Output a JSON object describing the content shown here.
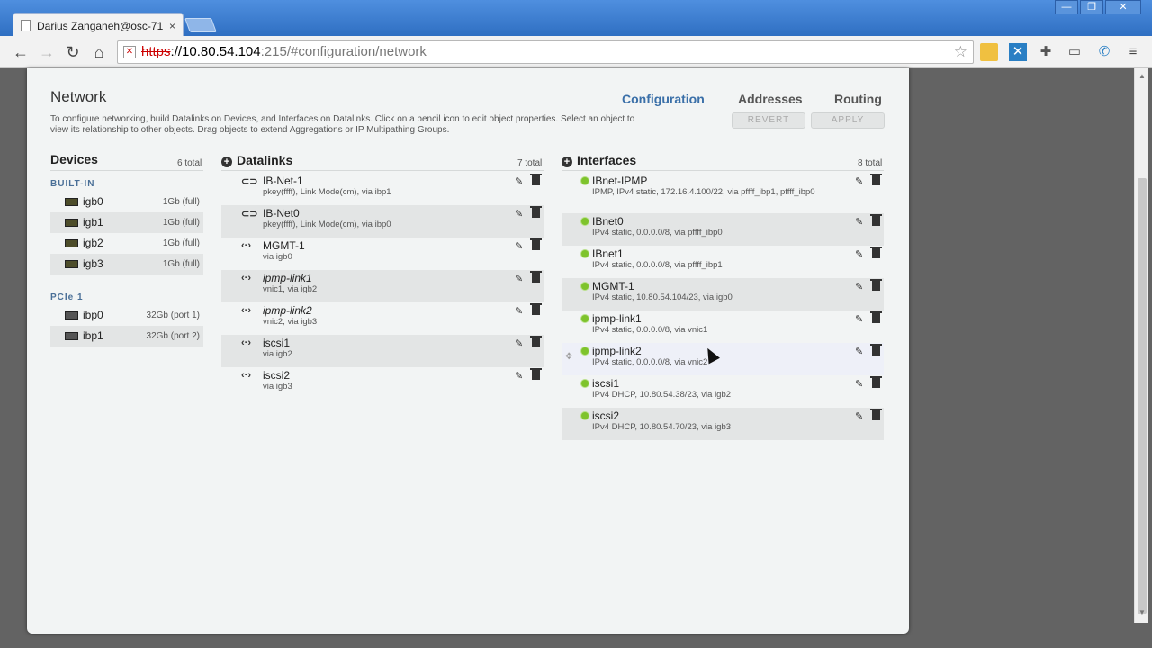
{
  "browser": {
    "tab_title": "Darius Zanganeh@osc-71",
    "tab_close": "×",
    "url_scheme": "https",
    "url_host": "://10.80.54.104",
    "url_path": ":215/#configuration/network",
    "window_buttons": [
      "—",
      "❐",
      "✕"
    ]
  },
  "page": {
    "title": "Network",
    "tabs": [
      "Configuration",
      "Addresses",
      "Routing"
    ],
    "active_tab": "Configuration",
    "description": "To configure networking, build Datalinks on Devices, and Interfaces on Datalinks. Click on a pencil icon to edit object properties. Select an object to view its relationship to other objects. Drag objects to extend Aggregations or IP Multipathing Groups.",
    "revert_label": "REVERT",
    "apply_label": "APPLY"
  },
  "devices": {
    "title": "Devices",
    "count": "6 total",
    "groups": [
      {
        "label": "BUILT-IN",
        "items": [
          {
            "name": "igb0",
            "speed": "1Gb (full)"
          },
          {
            "name": "igb1",
            "speed": "1Gb (full)"
          },
          {
            "name": "igb2",
            "speed": "1Gb (full)"
          },
          {
            "name": "igb3",
            "speed": "1Gb (full)"
          }
        ]
      },
      {
        "label": "PCIe 1",
        "items": [
          {
            "name": "ibp0",
            "speed": "32Gb (port 1)"
          },
          {
            "name": "ibp1",
            "speed": "32Gb (port 2)"
          }
        ]
      }
    ]
  },
  "datalinks": {
    "title": "Datalinks",
    "count": "7 total",
    "items": [
      {
        "icon": "⊂⊃",
        "name": "IB-Net-1",
        "sub": "pkey(ffff), Link Mode(cm), via ibp1"
      },
      {
        "icon": "⊂⊃",
        "name": "IB-Net0",
        "sub": "pkey(ffff), Link Mode(cm), via ibp0"
      },
      {
        "icon": "‹·›",
        "name": "MGMT-1",
        "sub": "via igb0"
      },
      {
        "icon": "‹·›",
        "name": "ipmp-link1",
        "sub": "vnic1, via igb2"
      },
      {
        "icon": "‹·›",
        "name": "ipmp-link2",
        "sub": "vnic2, via igb3"
      },
      {
        "icon": "‹·›",
        "name": "iscsi1",
        "sub": "via igb2"
      },
      {
        "icon": "‹·›",
        "name": "iscsi2",
        "sub": "via igb3"
      }
    ]
  },
  "interfaces": {
    "title": "Interfaces",
    "count": "8 total",
    "items": [
      {
        "name": "IBnet-IPMP",
        "sub": "IPMP, IPv4 static, 172.16.4.100/22, via pffff_ibp1, pffff_ibp0"
      },
      {
        "name": "IBnet0",
        "sub": "IPv4 static, 0.0.0.0/8, via pffff_ibp0"
      },
      {
        "name": "IBnet1",
        "sub": "IPv4 static, 0.0.0.0/8, via pffff_ibp1"
      },
      {
        "name": "MGMT-1",
        "sub": "IPv4 static, 10.80.54.104/23, via igb0"
      },
      {
        "name": "ipmp-link1",
        "sub": "IPv4 static, 0.0.0.0/8, via vnic1"
      },
      {
        "name": "ipmp-link2",
        "sub": "IPv4 static, 0.0.0.0/8, via vnic2"
      },
      {
        "name": "iscsi1",
        "sub": "IPv4 DHCP, 10.80.54.38/23, via igb2"
      },
      {
        "name": "iscsi2",
        "sub": "IPv4 DHCP, 10.80.54.70/23, via igb3"
      }
    ]
  },
  "icons": {
    "edit": "pencil-icon",
    "delete": "trash-icon",
    "status_up_color": "#7ec32c",
    "accent_color": "#3a6fa8"
  }
}
